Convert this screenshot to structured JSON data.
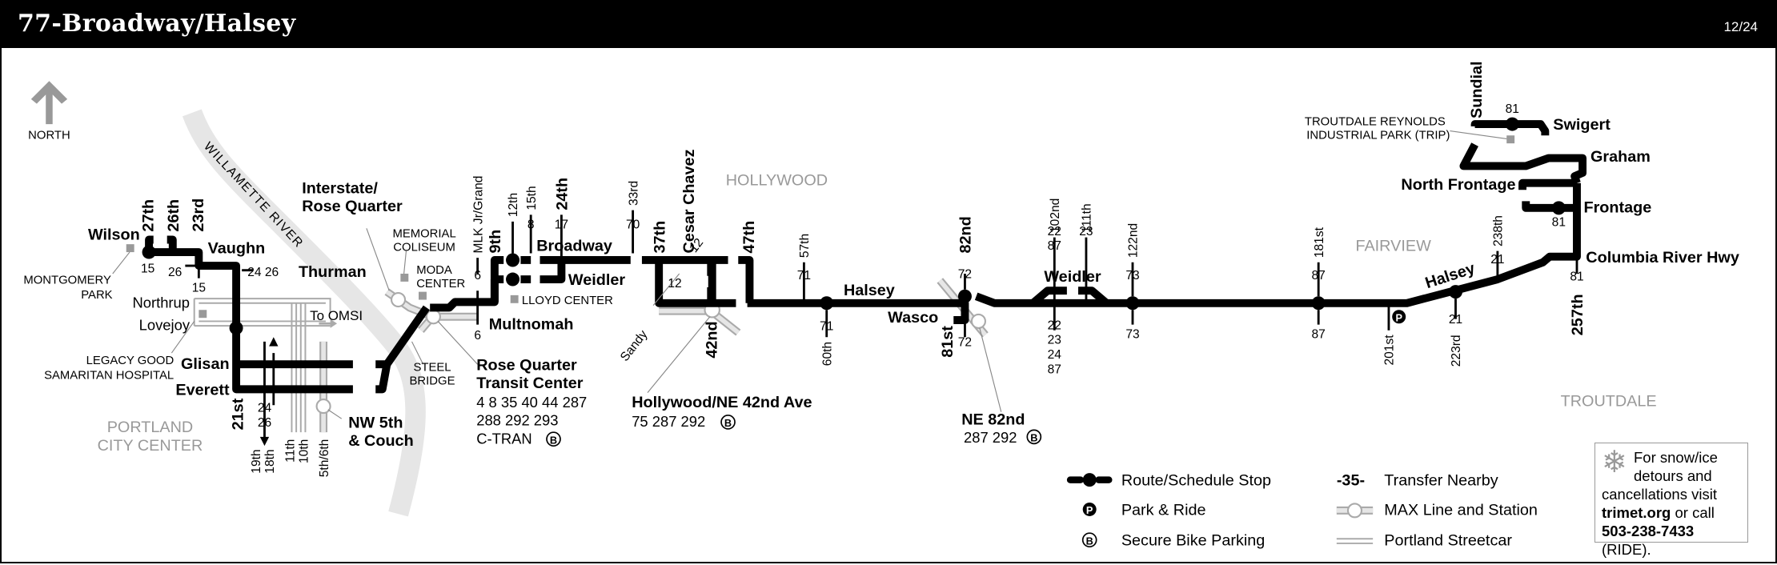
{
  "header": {
    "title": "77-Broadway/Halsey",
    "date": "12/24"
  },
  "compass": {
    "label": "NORTH",
    "icon": "north-arrow-icon"
  },
  "areas": {
    "hollywood": "HOLLYWOOD",
    "fairview": "FAIRVIEW",
    "troutdale": "TROUTDALE",
    "portland1": "PORTLAND",
    "portland2": "CITY CENTER",
    "river": "WILLAMETTE  RIVER"
  },
  "landmarks": {
    "montgomery1": "MONTGOMERY",
    "montgomery2": "PARK",
    "legacy1": "LEGACY GOOD",
    "legacy2": "SAMARITAN HOSPITAL",
    "memorial1": "MEMORIAL",
    "memorial2": "COLISEUM",
    "moda1": "MODA",
    "moda2": "CENTER",
    "lloyd": "LLOYD CENTER",
    "steel1": "STEEL",
    "steel2": "BRIDGE",
    "trip1": "TROUTDALE REYNOLDS",
    "trip2": "INDUSTRIAL PARK (TRIP)"
  },
  "streets": {
    "wilson": "Wilson",
    "s27": "27th",
    "s26": "26th",
    "s23": "23rd",
    "vaughn": "Vaughn",
    "thurman": "Thurman",
    "northrup": "Northrup",
    "lovejoy": "Lovejoy",
    "glisan": "Glisan",
    "everett": "Everett",
    "s21": "21st",
    "s19": "19th",
    "s18": "18th",
    "s11": "11th",
    "s10": "10th",
    "s5_6": "5th/6th",
    "to_omsi": "To OMSI",
    "multnomah": "Multnomah",
    "mlk": "MLK Jr/Grand",
    "s9": "9th",
    "s12": "12th",
    "s15": "15th",
    "broadway": "Broadway",
    "weidler": "Weidler",
    "s24": "24th",
    "s33": "33rd",
    "s37": "37th",
    "cesar": "Cesar Chavez",
    "s47": "47th",
    "s57": "57th",
    "sandy": "Sandy",
    "s42": "42nd",
    "s60": "60th",
    "halsey": "Halsey",
    "wasco": "Wasco",
    "s81": "81st",
    "s82": "82nd",
    "s102": "102nd",
    "s111": "111th",
    "weidler2": "Weidler",
    "s122": "122nd",
    "s181": "181st",
    "s201": "201st",
    "s223": "223rd",
    "halsey2": "Halsey",
    "s238": "238th",
    "s257": "257th",
    "columbia": "Columbia River Hwy",
    "frontage": "Frontage",
    "north_frontage": "North Frontage",
    "graham": "Graham",
    "swigert": "Swigert",
    "sundial": "Sundial"
  },
  "transfers": {
    "t15a": "15",
    "t26a": "26",
    "t15b": "15",
    "t24_26": "24 26",
    "t6a": "6",
    "t6b": "6",
    "t8": "8",
    "t17": "17",
    "t70": "70",
    "t12a": "12",
    "t12b": "12",
    "t71a": "71",
    "t71b": "71",
    "t72a": "72",
    "t72b": "72",
    "t22_87": [
      "22",
      "87"
    ],
    "t23": "23",
    "t22_23_24_87": [
      "22",
      "23",
      "24",
      "87"
    ],
    "t73a": "73",
    "t73b": "73",
    "t87a": "87",
    "t87b": "87",
    "t21a": "21",
    "t21b": "21",
    "t81a": "81",
    "t81b": "81",
    "t81c": "81",
    "t24": "24",
    "t26": "26"
  },
  "stations": {
    "interstate1": "Interstate/",
    "interstate2": "Rose Quarter",
    "rq1": "Rose Quarter",
    "rq2": "Transit Center",
    "rq_lines1": "4 8 35 40 44 287",
    "rq_lines2": "288 292 293",
    "rq_lines3": "C-TRAN",
    "nw5_1": "NW 5th",
    "nw5_2": "& Couch",
    "hollywood1": "Hollywood/NE 42nd Ave",
    "hollywood_lines": "75 287 292",
    "ne82_1": "NE 82nd",
    "ne82_lines": "287 292"
  },
  "legend": {
    "stop": "Route/Schedule Stop",
    "park_ride": "Park & Ride",
    "bike": "Secure Bike Parking",
    "transfer_sym": "-35-",
    "transfer": "Transfer Nearby",
    "max": "MAX Line and Station",
    "streetcar": "Portland Streetcar"
  },
  "note": {
    "line1": "For snow/ice",
    "line2": "detours and",
    "line3": "cancellations visit",
    "link": "trimet.org",
    "line4": " or call",
    "phone": "503-238-7433",
    "line5": " (RIDE)."
  },
  "symbols": {
    "park_ride": "P",
    "bike": "B"
  }
}
